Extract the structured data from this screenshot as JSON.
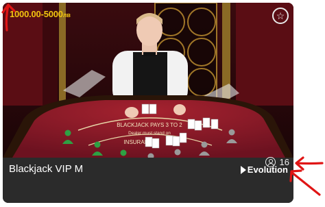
{
  "card": {
    "bet_limit": "1000.00-5000",
    "currency": "лв",
    "players_count": "16",
    "game_title": "Blackjack VIP M",
    "provider": "Evolution"
  },
  "table": {
    "felt_line1": "BLACKJACK PAYS 3 TO 2",
    "felt_line2": "Dealer must stand on",
    "felt_line3": "INSURANCE"
  },
  "seats": {
    "occupied": 4,
    "total": 7
  },
  "colors": {
    "limit_text": "#f1c40f",
    "felt": "#8e1b2a",
    "annotation": "#e01515",
    "occupied_seat": "#2ea043",
    "empty_seat": "#9a9a9a"
  },
  "icons": [
    "star-icon",
    "user-icon",
    "evolution-logo"
  ]
}
